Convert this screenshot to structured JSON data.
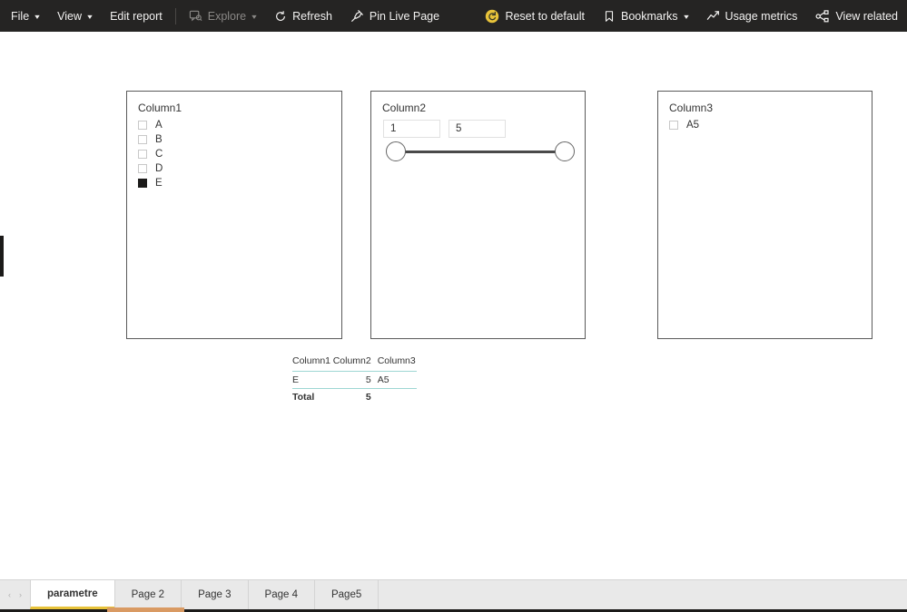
{
  "toolbar": {
    "items": [
      {
        "label": "File",
        "icon": "chevron-down-icon",
        "has_chevron": true,
        "disabled": false
      },
      {
        "label": "View",
        "icon": "chevron-down-icon",
        "has_chevron": true,
        "disabled": false
      },
      {
        "label": "Edit report",
        "icon": "",
        "has_chevron": false,
        "disabled": false
      },
      {
        "label": "Explore",
        "icon": "explore-icon",
        "has_chevron": true,
        "disabled": true
      },
      {
        "label": "Refresh",
        "icon": "refresh-icon",
        "has_chevron": false,
        "disabled": false
      },
      {
        "label": "Pin Live Page",
        "icon": "pin-icon",
        "has_chevron": false,
        "disabled": false
      }
    ],
    "right_items": [
      {
        "label": "Reset to default",
        "icon": "reset-icon",
        "has_chevron": false
      },
      {
        "label": "Bookmarks",
        "icon": "bookmark-icon",
        "has_chevron": true
      },
      {
        "label": "Usage metrics",
        "icon": "usage-metrics-icon",
        "has_chevron": false
      },
      {
        "label": "View related",
        "icon": "view-related-icon",
        "has_chevron": false
      }
    ],
    "background_color": "#252423",
    "accent_color": "#e8c33a"
  },
  "slicers": {
    "column1": {
      "title": "Column1",
      "items": [
        {
          "label": "A",
          "checked": false
        },
        {
          "label": "B",
          "checked": false
        },
        {
          "label": "C",
          "checked": false
        },
        {
          "label": "D",
          "checked": false
        },
        {
          "label": "E",
          "checked": true
        }
      ]
    },
    "column2": {
      "title": "Column2",
      "min_value": "1",
      "max_value": "5",
      "min_placeholder": "1",
      "max_placeholder": "5"
    },
    "column3": {
      "title": "Column3",
      "items": [
        {
          "label": "A5",
          "checked": false
        }
      ]
    }
  },
  "table": {
    "headers": [
      "Column1",
      "Column2",
      "Column3"
    ],
    "rows": [
      {
        "column1": "E",
        "column2": "5",
        "column3": "A5"
      }
    ],
    "total": {
      "label": "Total",
      "column2": "5",
      "column3": ""
    },
    "divider_color": "#9ed7d3"
  },
  "pages": {
    "tabs": [
      {
        "label": "parametre",
        "active": true
      },
      {
        "label": "Page 2",
        "active": false
      },
      {
        "label": "Page 3",
        "active": false
      },
      {
        "label": "Page 4",
        "active": false
      },
      {
        "label": "Page5",
        "active": false
      }
    ],
    "nav_prev": "‹",
    "nav_next": "›"
  }
}
